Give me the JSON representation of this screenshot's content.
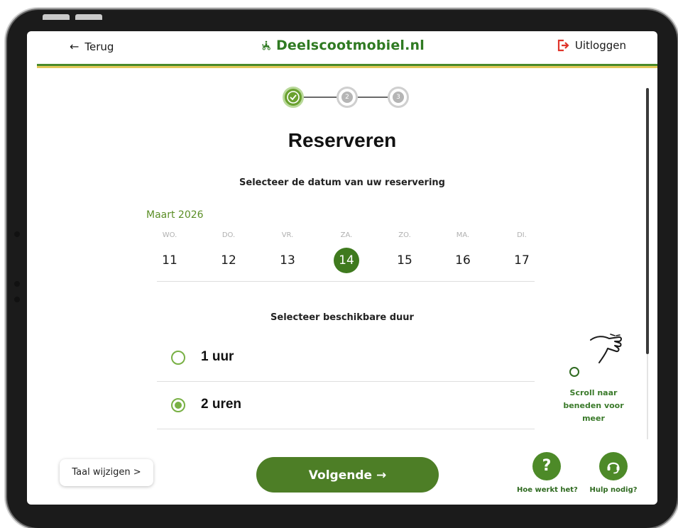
{
  "header": {
    "back_label": "Terug",
    "brand_name": "Deelscootmobiel.nl",
    "logout_label": "Uitloggen"
  },
  "steps": {
    "items": [
      {
        "number": "1",
        "state": "completed"
      },
      {
        "number": "2",
        "state": "pending"
      },
      {
        "number": "3",
        "state": "pending"
      }
    ]
  },
  "page": {
    "title": "Reserveren",
    "date_prompt": "Selecteer de datum van uw reservering",
    "duration_prompt": "Selecteer beschikbare duur"
  },
  "calendar": {
    "month_label": "Maart 2026",
    "weekdays": [
      "WO.",
      "DO.",
      "VR.",
      "ZA.",
      "ZO.",
      "MA.",
      "DI."
    ],
    "days": [
      "11",
      "12",
      "13",
      "14",
      "15",
      "16",
      "17"
    ],
    "selected_day": "14"
  },
  "durations": {
    "options": [
      {
        "label": "1 uur",
        "selected": false
      },
      {
        "label": "2 uren",
        "selected": true
      }
    ]
  },
  "scroll_hint": {
    "text_line1": "Scroll naar",
    "text_line2": "beneden voor",
    "text_line3": "meer"
  },
  "footer": {
    "language_button": "Taal wijzigen >",
    "next_button": "Volgende →",
    "how_it_works_label": "Hoe werkt het?",
    "help_label": "Hulp nodig?"
  },
  "colors": {
    "brand_green": "#2f7a22",
    "button_green": "#4d7e26",
    "accent_green": "#78b044",
    "logout_red": "#e0342a",
    "stripe_yellow": "#e3c95a"
  }
}
